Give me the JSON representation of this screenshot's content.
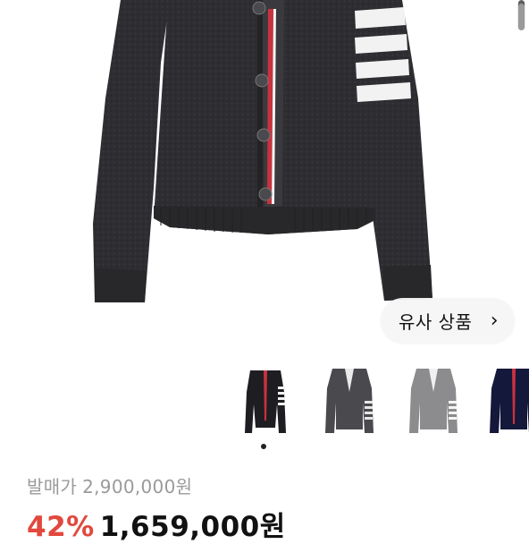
{
  "similar_button": {
    "label": "유사 상품",
    "chevron": "›"
  },
  "thumbnails": [
    {
      "name": "black cardigan"
    },
    {
      "name": "charcoal cardigan"
    },
    {
      "name": "light grey cardigan"
    },
    {
      "name": "navy cardigan"
    }
  ],
  "carousel": {
    "active_index": 0,
    "count": 1
  },
  "pricing": {
    "retail_label": "발매가",
    "retail_price": "2,900,000원",
    "discount": "42%",
    "price": "1,659,000원"
  },
  "colors": {
    "discount_red": "#e2483d",
    "muted_grey": "#9a9a9a",
    "knit_charcoal": "#2f2f33"
  },
  "icons": {
    "similar_chevron": "chevron-right-icon"
  }
}
